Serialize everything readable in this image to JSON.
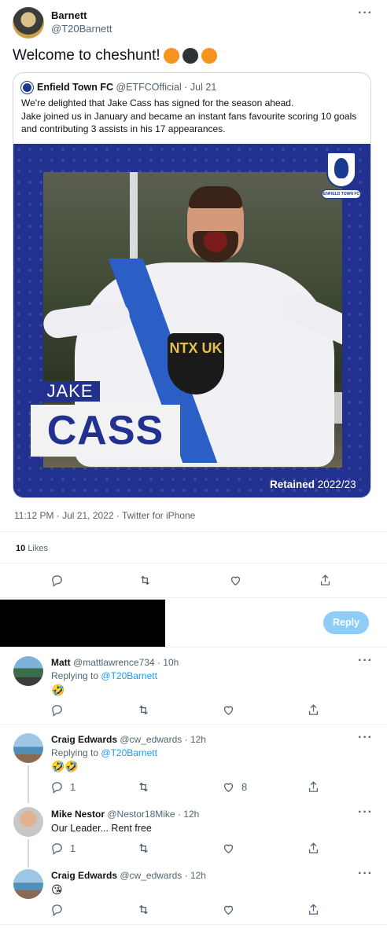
{
  "main_tweet": {
    "author_name": "Barnett",
    "author_handle": "@T20Barnett",
    "text": "Welcome to cheshunt! ",
    "circle_colors": [
      "#f7931e",
      "#2f3336",
      "#f7931e"
    ],
    "quoted": {
      "author_name": "Enfield Town FC",
      "author_handle": "@ETFCOfficial",
      "date": "Jul 21",
      "line1": "We're delighted that Jake Cass has signed for the season ahead.",
      "line2": "Jake joined us in January and became an instant fans favourite scoring 10 goals",
      "line3": "and contributing 3 assists in his 17 appearances.",
      "graphic": {
        "first_name": "JAKE",
        "last_name": "CASS",
        "retained_label": "Retained",
        "season": "2022/23",
        "badge_text": "ENFIELD TOWN FC",
        "shirt_sponsor": "NTX UK"
      }
    },
    "timestamp": "11:12 PM · Jul 21, 2022 · Twitter for iPhone",
    "likes_count": "10",
    "likes_label": "Likes"
  },
  "reply_box": {
    "button_label": "Reply"
  },
  "replies": [
    {
      "name": "Matt",
      "handle": "@mattlawrence734",
      "time": "10h",
      "replying_to_label": "Replying to",
      "replying_to_handle": "@T20Barnett",
      "text": "🤣",
      "reply_count": "",
      "like_count": ""
    },
    {
      "name": "Craig Edwards",
      "handle": "@cw_edwards",
      "time": "12h",
      "replying_to_label": "Replying to",
      "replying_to_handle": "@T20Barnett",
      "text": "🤣🤣",
      "reply_count": "1",
      "like_count": "8"
    },
    {
      "name": "Mike Nestor",
      "handle": "@Nestor18Mike",
      "time": "12h",
      "text": "Our Leader... Rent free",
      "reply_count": "1",
      "like_count": ""
    },
    {
      "name": "Craig Edwards",
      "handle": "@cw_edwards",
      "time": "12h",
      "text": "😘",
      "reply_count": "",
      "like_count": ""
    }
  ]
}
